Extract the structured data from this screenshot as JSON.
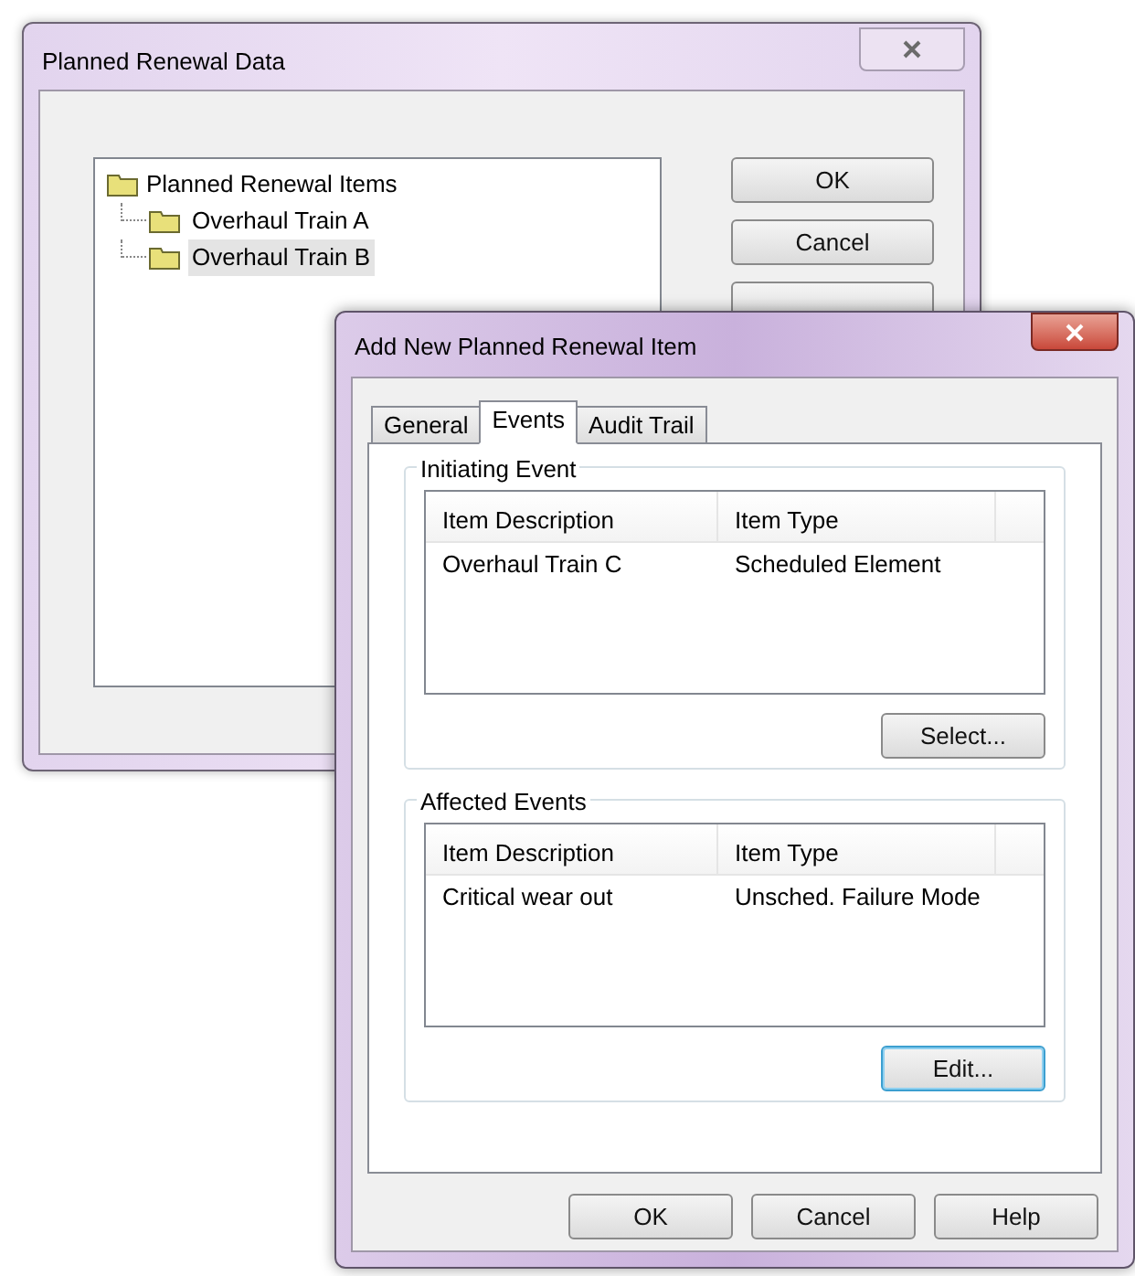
{
  "back_window": {
    "title": "Planned Renewal Data",
    "tree": {
      "label": "Planned Renewal Items",
      "children": [
        {
          "label": "Overhaul Train A",
          "selected": false
        },
        {
          "label": "Overhaul Train B",
          "selected": true
        }
      ]
    },
    "buttons": [
      "OK",
      "Cancel"
    ]
  },
  "front_window": {
    "title": "Add New Planned Renewal Item",
    "tabs": [
      {
        "label": "General",
        "selected": false
      },
      {
        "label": "Events",
        "selected": true
      },
      {
        "label": "Audit Trail",
        "selected": false
      }
    ],
    "groups": [
      {
        "title": "Initiating Event",
        "columns": [
          "Item Description",
          "Item Type"
        ],
        "rows": [
          [
            "Overhaul Train C",
            "Scheduled Element"
          ]
        ],
        "button": {
          "label": "Select...",
          "focused": false
        }
      },
      {
        "title": "Affected Events",
        "columns": [
          "Item Description",
          "Item Type"
        ],
        "rows": [
          [
            "Critical wear out",
            "Unsched. Failure Mode"
          ]
        ],
        "button": {
          "label": "Edit...",
          "focused": true
        }
      }
    ],
    "buttons": [
      "OK",
      "Cancel",
      "Help"
    ]
  }
}
